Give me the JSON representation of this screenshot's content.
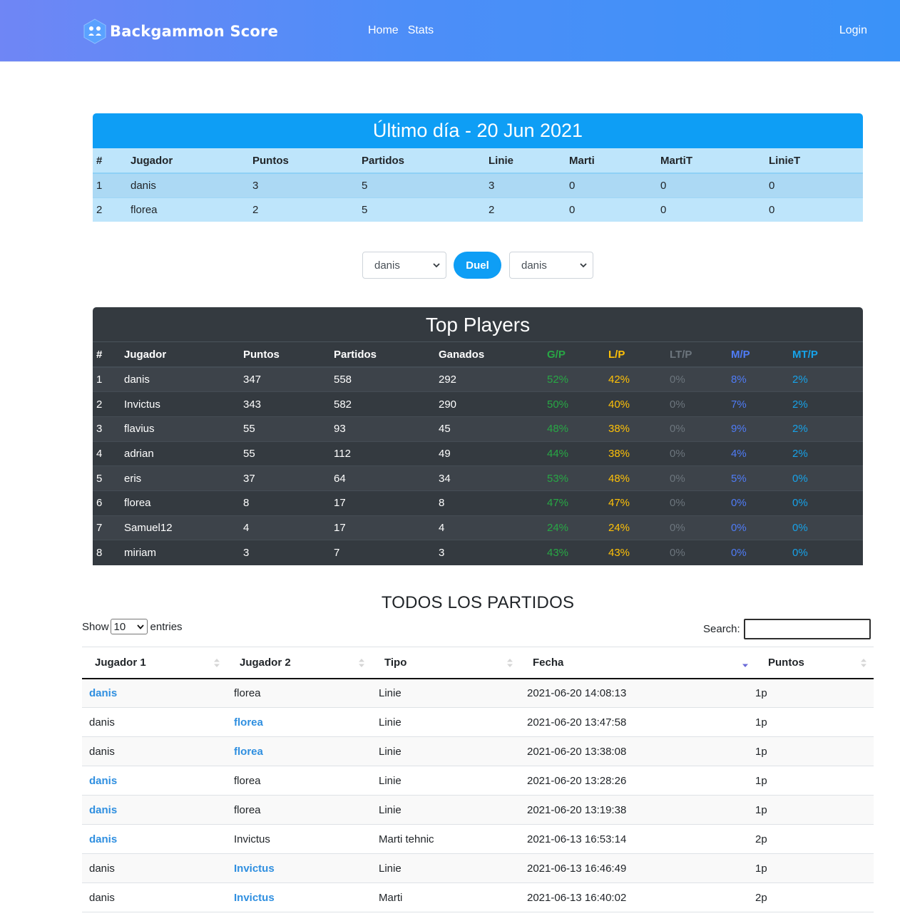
{
  "nav": {
    "brand": "Backgammon Score",
    "links": [
      "Home",
      "Stats"
    ],
    "login": "Login"
  },
  "last_day": {
    "title": "Último día - 20 Jun 2021",
    "columns": [
      "#",
      "Jugador",
      "Puntos",
      "Partidos",
      "Linie",
      "Marti",
      "MartiT",
      "LinieT"
    ],
    "rows": [
      [
        "1",
        "danis",
        "3",
        "5",
        "3",
        "0",
        "0",
        "0"
      ],
      [
        "2",
        "florea",
        "2",
        "5",
        "2",
        "0",
        "0",
        "0"
      ]
    ]
  },
  "duel": {
    "player1": "danis",
    "button": "Duel",
    "player2": "danis"
  },
  "top_players": {
    "title": "Top Players",
    "columns": [
      "#",
      "Jugador",
      "Puntos",
      "Partidos",
      "Ganados",
      "G/P",
      "L/P",
      "LT/P",
      "M/P",
      "MT/P"
    ],
    "rows": [
      [
        "1",
        "danis",
        "347",
        "558",
        "292",
        "52%",
        "42%",
        "0%",
        "8%",
        "2%"
      ],
      [
        "2",
        "Invictus",
        "343",
        "582",
        "290",
        "50%",
        "40%",
        "0%",
        "7%",
        "2%"
      ],
      [
        "3",
        "flavius",
        "55",
        "93",
        "45",
        "48%",
        "38%",
        "0%",
        "9%",
        "2%"
      ],
      [
        "4",
        "adrian",
        "55",
        "112",
        "49",
        "44%",
        "38%",
        "0%",
        "4%",
        "2%"
      ],
      [
        "5",
        "eris",
        "37",
        "64",
        "34",
        "53%",
        "48%",
        "0%",
        "5%",
        "0%"
      ],
      [
        "6",
        "florea",
        "8",
        "17",
        "8",
        "47%",
        "47%",
        "0%",
        "0%",
        "0%"
      ],
      [
        "7",
        "Samuel12",
        "4",
        "17",
        "4",
        "24%",
        "24%",
        "0%",
        "0%",
        "0%"
      ],
      [
        "8",
        "miriam",
        "3",
        "7",
        "3",
        "43%",
        "43%",
        "0%",
        "0%",
        "0%"
      ]
    ],
    "colors": {
      "G/P": "#28a745",
      "L/P": "#ffc107",
      "LT/P": "#6c757d",
      "M/P": "#4f7cf6",
      "MT/P": "#17a2e8"
    }
  },
  "all_matches": {
    "title": "TODOS LOS PARTIDOS",
    "show_label": "Show",
    "show_value": "10",
    "entries_label": "entries",
    "search_label": "Search:",
    "search_value": "",
    "columns": [
      "Jugador 1",
      "Jugador 2",
      "Tipo",
      "Fecha",
      "Puntos"
    ],
    "sorted_column": "Fecha",
    "rows": [
      {
        "p1": "danis",
        "p2": "florea",
        "tipo": "Linie",
        "fecha": "2021-06-20 14:08:13",
        "puntos": "1p",
        "winner": 1
      },
      {
        "p1": "danis",
        "p2": "florea",
        "tipo": "Linie",
        "fecha": "2021-06-20 13:47:58",
        "puntos": "1p",
        "winner": 2
      },
      {
        "p1": "danis",
        "p2": "florea",
        "tipo": "Linie",
        "fecha": "2021-06-20 13:38:08",
        "puntos": "1p",
        "winner": 2
      },
      {
        "p1": "danis",
        "p2": "florea",
        "tipo": "Linie",
        "fecha": "2021-06-20 13:28:26",
        "puntos": "1p",
        "winner": 1
      },
      {
        "p1": "danis",
        "p2": "florea",
        "tipo": "Linie",
        "fecha": "2021-06-20 13:19:38",
        "puntos": "1p",
        "winner": 1
      },
      {
        "p1": "danis",
        "p2": "Invictus",
        "tipo": "Marti tehnic",
        "fecha": "2021-06-13 16:53:14",
        "puntos": "2p",
        "winner": 1
      },
      {
        "p1": "danis",
        "p2": "Invictus",
        "tipo": "Linie",
        "fecha": "2021-06-13 16:46:49",
        "puntos": "1p",
        "winner": 2
      },
      {
        "p1": "danis",
        "p2": "Invictus",
        "tipo": "Marti",
        "fecha": "2021-06-13 16:40:02",
        "puntos": "2p",
        "winner": 2
      }
    ],
    "winner_color": "#2f8fe0"
  }
}
